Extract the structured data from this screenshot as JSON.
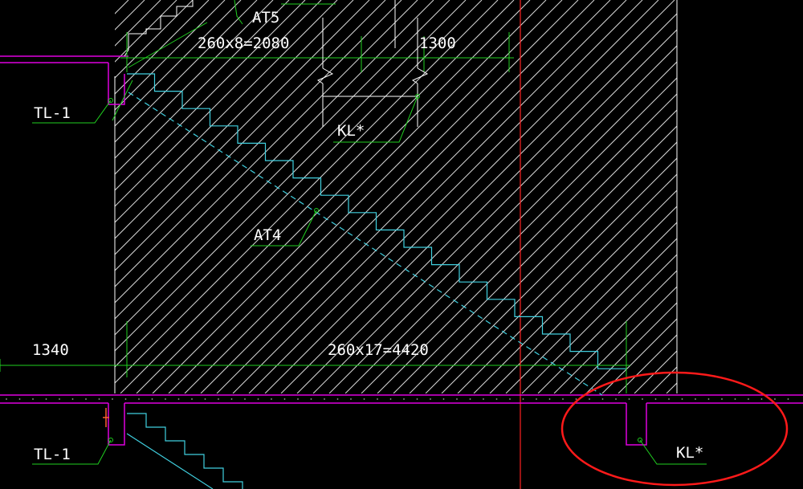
{
  "drawing": {
    "labels": {
      "at5": "AT5",
      "at4": "AT4",
      "tl1_top": "TL-1",
      "tl1_bottom": "TL-1",
      "kl_top": "KL*",
      "kl_bottom": "KL*"
    },
    "dimensions": {
      "upper_flight": "260x8=2080",
      "upper_right": "1300",
      "lower_left": "1340",
      "lower_flight": "260x17=4420"
    },
    "colors": {
      "background": "#000000",
      "hatch": "#d8d8d8",
      "slab": "#e000e0",
      "stairs": "#40d0e0",
      "dimension": "#20d020",
      "label": "#ffffff",
      "axis": "#ff2020",
      "highlight": "#ff1a1a",
      "rebar": "#ff6030"
    }
  }
}
